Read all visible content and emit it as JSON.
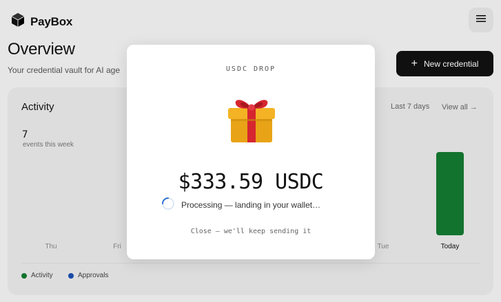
{
  "brand": {
    "name": "PayBox"
  },
  "header": {
    "menu_icon": "hamburger-icon"
  },
  "page": {
    "title": "Overview",
    "subtitle": "Your credential vault for AI age",
    "new_button": {
      "label": "New credential",
      "icon": "plus-icon"
    }
  },
  "activity": {
    "title": "Activity",
    "range": "Last 7 days",
    "view_all": "View all →",
    "count": "7",
    "count_label": "events this week",
    "days": [
      "Thu",
      "Fri",
      "Tue",
      "Today"
    ],
    "legend": [
      {
        "label": "Activity",
        "color": "#137a31"
      },
      {
        "label": "Approvals",
        "color": "#1a4fb0"
      }
    ]
  },
  "modal": {
    "eyebrow": "USDC DROP",
    "icon": "gift-icon",
    "amount": "$333.59 USDC",
    "status": "Processing — landing in your wallet…",
    "close_label": "Close — we'll keep sending it"
  }
}
